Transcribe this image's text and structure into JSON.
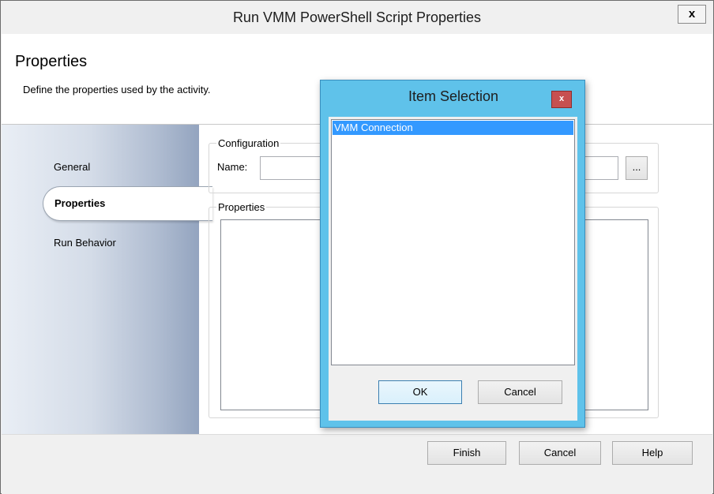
{
  "window": {
    "title": "Run VMM PowerShell Script Properties",
    "close_label": "x"
  },
  "header": {
    "title": "Properties",
    "description": "Define the properties used by the activity."
  },
  "sidebar": {
    "items": [
      {
        "label": "General"
      },
      {
        "label": "Properties",
        "selected": true
      },
      {
        "label": "Run Behavior"
      }
    ]
  },
  "main": {
    "configuration": {
      "group_label": "Configuration",
      "name_label": "Name:",
      "name_value": "",
      "browse_label": "..."
    },
    "properties": {
      "group_label": "Properties"
    }
  },
  "footer": {
    "finish_label": "Finish",
    "cancel_label": "Cancel",
    "help_label": "Help"
  },
  "dialog": {
    "title": "Item Selection",
    "close_label": "x",
    "items": [
      "VMM Connection"
    ],
    "ok_label": "OK",
    "cancel_label": "Cancel"
  },
  "colors": {
    "dialog_frame": "#5fc2ea",
    "selection": "#3399ff",
    "dialog_close": "#c75050"
  }
}
